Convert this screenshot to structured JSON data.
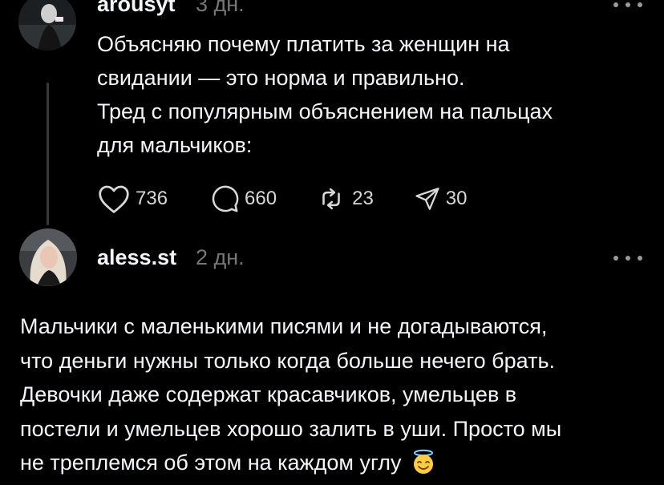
{
  "colors": {
    "background": "#000000",
    "text": "#f3f5f7",
    "muted": "#777777",
    "thread_line": "#3a3a3a"
  },
  "post": {
    "username": "arousyt",
    "time": "3 дн.",
    "lines": [
      "Объясняю почему платить за женщин на",
      "свидании — это норма и правильно.",
      "Тред с популярным объяснением на пальцах",
      "для мальчиков:"
    ],
    "likes": "736",
    "comments": "660",
    "reposts": "23",
    "shares": "30",
    "icons": [
      "heart-icon",
      "comment-icon",
      "repost-icon",
      "share-icon",
      "more-icon"
    ]
  },
  "reply": {
    "username": "aless.st",
    "time": "2 дн.",
    "lines": [
      "Мальчики с маленькими писями и не догадываются,",
      "что деньги нужны только когда больше нечего брать.",
      "Девочки даже содержат красавчиков, умельцев в",
      "постели и умельцев хорошо залить в уши. Просто мы",
      "не треплемся об этом на каждом углу"
    ],
    "emoji": "smiling-face-with-halo-emoji"
  }
}
